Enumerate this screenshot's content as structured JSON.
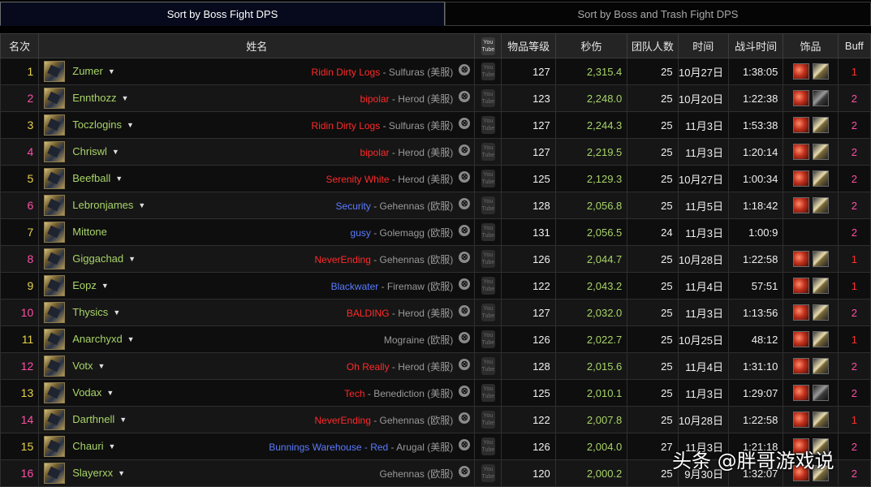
{
  "tabs": [
    {
      "label": "Sort by Boss Fight DPS",
      "active": true
    },
    {
      "label": "Sort by Boss and Trash Fight DPS",
      "active": false
    }
  ],
  "headers": {
    "rank": "名次",
    "name": "姓名",
    "youtube": "You Tube",
    "item_level": "物品等级",
    "dps": "秒伤",
    "raid_size": "团队人数",
    "time": "时间",
    "duration": "战斗时间",
    "trinkets": "饰品",
    "buff": "Buff"
  },
  "colors": {
    "rank_odd": "#e8d24a",
    "rank_even": "#ff4fa6",
    "guild_red": "#ff2a2a",
    "guild_blue": "#5b7bff",
    "buff_red": "#ff3030",
    "buff_pink": "#ff4fa6",
    "name_green": "#a8d468"
  },
  "rows": [
    {
      "rank": "1",
      "name": "Zumer",
      "guild": "Ridin Dirty Logs",
      "guild_color": "red",
      "server": " - Sulfuras (美服)",
      "ilvl": "127",
      "dps": "2,315.4",
      "size": "25",
      "date": "10月27日",
      "duration": "1:38:05",
      "trinkets": [
        "fire-trinket-icon",
        "trinket-icon"
      ],
      "buff": "1"
    },
    {
      "rank": "2",
      "name": "Ennthozz",
      "guild": "bipolar",
      "guild_color": "red",
      "server": " - Herod (美服)",
      "ilvl": "123",
      "dps": "2,248.0",
      "size": "25",
      "date": "10月20日",
      "duration": "1:22:38",
      "trinkets": [
        "fire-trinket-icon",
        "trinket-icon-dark"
      ],
      "buff": "2"
    },
    {
      "rank": "3",
      "name": "Toczlogins",
      "guild": "Ridin Dirty Logs",
      "guild_color": "red",
      "server": " - Sulfuras (美服)",
      "ilvl": "127",
      "dps": "2,244.3",
      "size": "25",
      "date": "11月3日",
      "duration": "1:53:38",
      "trinkets": [
        "fire-trinket-icon",
        "trinket-icon"
      ],
      "buff": "2"
    },
    {
      "rank": "4",
      "name": "Chriswl",
      "guild": "bipolar",
      "guild_color": "red",
      "server": " - Herod (美服)",
      "ilvl": "127",
      "dps": "2,219.5",
      "size": "25",
      "date": "11月3日",
      "duration": "1:20:14",
      "trinkets": [
        "fire-trinket-icon",
        "trinket-icon"
      ],
      "buff": "2"
    },
    {
      "rank": "5",
      "name": "Beefball",
      "guild": "Serenity White",
      "guild_color": "red",
      "server": " - Herod (美服)",
      "ilvl": "125",
      "dps": "2,129.3",
      "size": "25",
      "date": "10月27日",
      "duration": "1:00:34",
      "trinkets": [
        "fire-trinket-icon",
        "trinket-icon"
      ],
      "buff": "2"
    },
    {
      "rank": "6",
      "name": "Lebronjames",
      "guild": "Security",
      "guild_color": "blue",
      "server": " - Gehennas (欧服)",
      "ilvl": "128",
      "dps": "2,056.8",
      "size": "25",
      "date": "11月5日",
      "duration": "1:18:42",
      "trinkets": [
        "fire-trinket-icon",
        "trinket-icon"
      ],
      "buff": "2"
    },
    {
      "rank": "7",
      "name": "Mittone",
      "guild": "gusy",
      "guild_color": "blue",
      "server": " - Golemagg (欧服)",
      "ilvl": "131",
      "dps": "2,056.5",
      "size": "24",
      "date": "11月3日",
      "duration": "1:00:9",
      "trinkets": [],
      "buff": "2",
      "no_caret": true
    },
    {
      "rank": "8",
      "name": "Giggachad",
      "guild": "NeverEnding",
      "guild_color": "red",
      "server": " - Gehennas (欧服)",
      "ilvl": "126",
      "dps": "2,044.7",
      "size": "25",
      "date": "10月28日",
      "duration": "1:22:58",
      "trinkets": [
        "fire-trinket-icon",
        "trinket-icon"
      ],
      "buff": "1"
    },
    {
      "rank": "9",
      "name": "Eopz",
      "guild": "Blackwater",
      "guild_color": "blue",
      "server": " - Firemaw (欧服)",
      "ilvl": "122",
      "dps": "2,043.2",
      "size": "25",
      "date": "11月4日",
      "duration": "57:51",
      "trinkets": [
        "fire-trinket-icon",
        "trinket-icon"
      ],
      "buff": "1"
    },
    {
      "rank": "10",
      "name": "Thysics",
      "guild": "BALDING",
      "guild_color": "red",
      "server": " - Herod (美服)",
      "ilvl": "127",
      "dps": "2,032.0",
      "size": "25",
      "date": "11月3日",
      "duration": "1:13:56",
      "trinkets": [
        "fire-trinket-icon",
        "trinket-icon"
      ],
      "buff": "2"
    },
    {
      "rank": "11",
      "name": "Anarchyxd",
      "guild": "",
      "guild_color": "red",
      "server": "Mograine (欧服)",
      "ilvl": "126",
      "dps": "2,022.7",
      "size": "25",
      "date": "10月25日",
      "duration": "48:12",
      "trinkets": [
        "fire-trinket-icon",
        "trinket-icon"
      ],
      "buff": "1"
    },
    {
      "rank": "12",
      "name": "Votx",
      "guild": "Oh Really",
      "guild_color": "red",
      "server": " - Herod (美服)",
      "ilvl": "128",
      "dps": "2,015.6",
      "size": "25",
      "date": "11月4日",
      "duration": "1:31:10",
      "trinkets": [
        "fire-trinket-icon",
        "trinket-icon"
      ],
      "buff": "2"
    },
    {
      "rank": "13",
      "name": "Vodax",
      "guild": "Tech",
      "guild_color": "red",
      "server": " - Benediction (美服)",
      "ilvl": "125",
      "dps": "2,010.1",
      "size": "25",
      "date": "11月3日",
      "duration": "1:29:07",
      "trinkets": [
        "fire-trinket-icon",
        "trinket-icon-dark"
      ],
      "buff": "2"
    },
    {
      "rank": "14",
      "name": "Darthnell",
      "guild": "NeverEnding",
      "guild_color": "red",
      "server": " - Gehennas (欧服)",
      "ilvl": "122",
      "dps": "2,007.8",
      "size": "25",
      "date": "10月28日",
      "duration": "1:22:58",
      "trinkets": [
        "fire-trinket-icon",
        "trinket-icon"
      ],
      "buff": "1"
    },
    {
      "rank": "15",
      "name": "Chauri",
      "guild": "Bunnings Warehouse - Red",
      "guild_color": "blue",
      "server": " - Arugal (美服)",
      "ilvl": "126",
      "dps": "2,004.0",
      "size": "27",
      "date": "11月3日",
      "duration": "1:21:18",
      "trinkets": [
        "fire-trinket-icon",
        "trinket-icon"
      ],
      "buff": "2"
    },
    {
      "rank": "16",
      "name": "Slayerxx",
      "guild": "",
      "guild_color": "red",
      "server": "Gehennas (欧服)",
      "ilvl": "120",
      "dps": "2,000.2",
      "size": "25",
      "date": "9月30日",
      "duration": "1:32:07",
      "trinkets": [
        "fire-trinket-icon",
        "trinket-icon"
      ],
      "buff": "2"
    }
  ],
  "watermark": "头条 @胖哥游戏说"
}
